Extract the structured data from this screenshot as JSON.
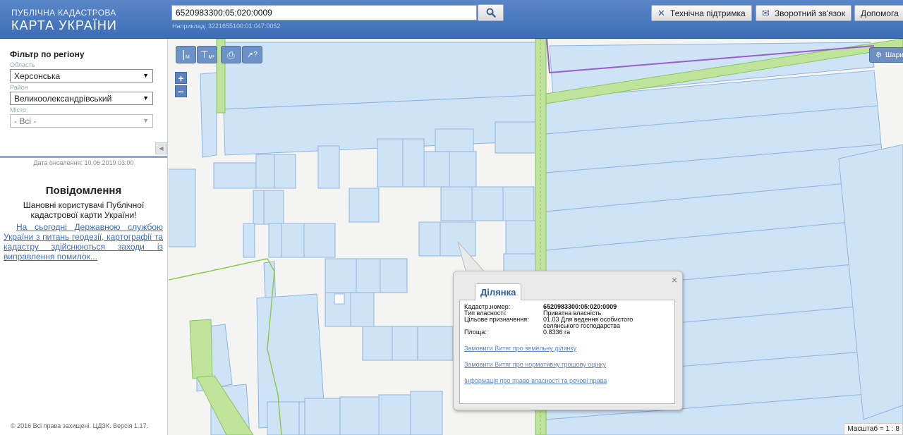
{
  "header": {
    "logo_line1": "ПУБЛІЧНА КАДАСТРОВА",
    "logo_line2": "КАРТА УКРАЇНИ",
    "search_value": "6520983300:05:020:0009",
    "search_hint": "Наприклад: 3221655100:01:047:0052",
    "support_label": "Технічна підтримка",
    "feedback_label": "Зворотний зв'язок",
    "help_label": "Допомога"
  },
  "sidebar": {
    "filter_title": "Фільтр по регіону",
    "oblast_label": "Область",
    "oblast_value": "Херсонська",
    "raion_label": "Район",
    "raion_value": "Великоолександрівський",
    "misto_label": "Місто",
    "misto_value": "- Всі -",
    "update_date": "Дата оновлення: 10.06.2019 03:00",
    "message_title": "Повідомлення",
    "message_body": "Шановні користувачі Публічної кадастрової карти України!",
    "message_link": "На сьогодні Державною службою України з питань геодезії, картографії та кадастру здійснюються заходи із виправлення помилок...",
    "copyright": "© 2016 Всі права захищені. ЦДЗК. Версія 1.17."
  },
  "map": {
    "tool_measure_line": "M",
    "tool_measure_area": "M²",
    "tool_query": "?",
    "layers_label": "Шари",
    "scale_label": "Масштаб = 1 : 8",
    "zoom_in": "+",
    "zoom_out": "−"
  },
  "popup": {
    "tab_label": "Ділянка",
    "rows": [
      {
        "key": "Кадастр.номер:",
        "value": "6520983300:05:020:0009",
        "bold": true
      },
      {
        "key": "Тип власності:",
        "value": "Приватна власність"
      },
      {
        "key": "Цільове призначення:",
        "value": "01.03 Для ведення особистого селянського господарства"
      },
      {
        "key": "Площа:",
        "value": "0.8336 га"
      }
    ],
    "links": [
      "Замовити Витяг про земельну ділянку",
      "Замовити Витяг про нормативну грошову оцінку",
      "Інформація про право власності та речові права"
    ],
    "close": "×"
  },
  "colors": {
    "header": "#4a79bf",
    "parcel_fill": "#cfe3f7",
    "parcel_stroke": "#8fb6df",
    "road_green": "#bfe39a",
    "boundary_purple": "#9b5bd1"
  }
}
